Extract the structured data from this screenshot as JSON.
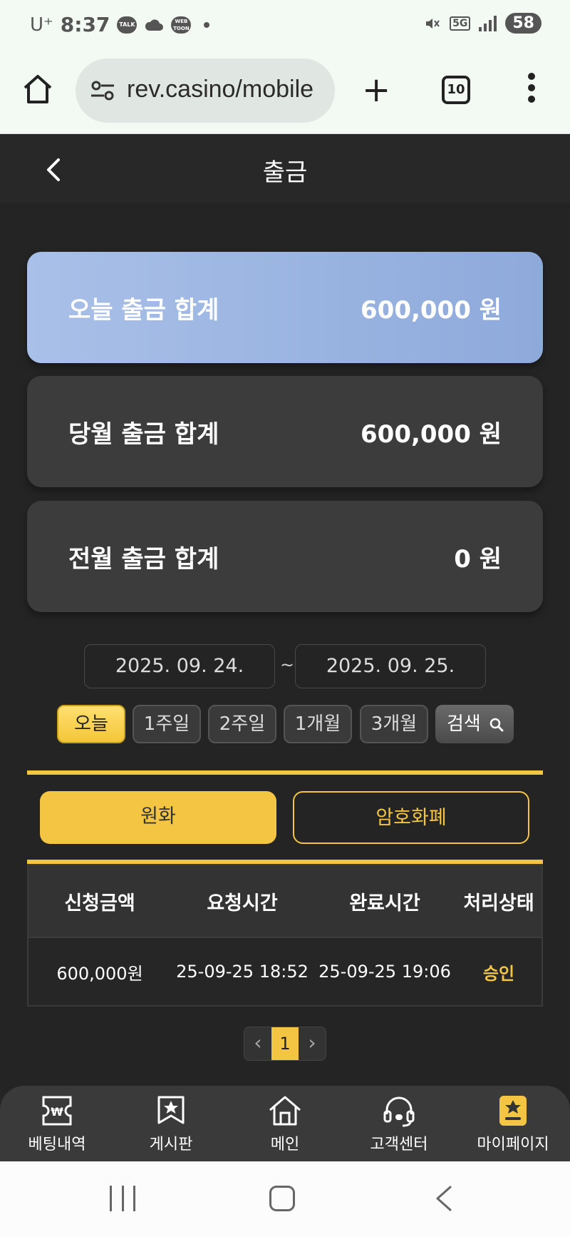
{
  "status_bar": {
    "carrier": "U⁺",
    "time": "8:37",
    "notif_talk": "TALK",
    "notif_webtoon": "WEB TOON",
    "network": "5G",
    "battery": "58"
  },
  "browser": {
    "url": "rev.casino/mobile",
    "tab_count": "10"
  },
  "header": {
    "title": "출금"
  },
  "summary": {
    "today_label": "오늘 출금 합계",
    "today_value": "600,000 원",
    "month_label": "당월 출금 합계",
    "month_value": "600,000 원",
    "prev_label": "전월 출금 합계",
    "prev_value": "0 원"
  },
  "filter": {
    "date_start": "2025. 09. 24.",
    "date_end": "2025. 09. 25.",
    "separator": "~",
    "periods": [
      "오늘",
      "1주일",
      "2주일",
      "1개월",
      "3개월"
    ],
    "active_period": "오늘",
    "search_label": "검색"
  },
  "currency_tabs": {
    "won": "원화",
    "crypto": "암호화폐",
    "active": "원화"
  },
  "table": {
    "headers": [
      "신청금액",
      "요청시간",
      "완료시간",
      "처리상태"
    ],
    "rows": [
      {
        "amount": "600,000원",
        "requested": "25-09-25 18:52",
        "completed": "25-09-25 19:06",
        "status": "승인"
      }
    ]
  },
  "pagination": {
    "current": "1",
    "prev": "‹",
    "next": "›"
  },
  "bottom_nav": {
    "items": [
      {
        "label": "베팅내역",
        "icon": "ticket-won-icon"
      },
      {
        "label": "게시판",
        "icon": "bookmark-star-icon"
      },
      {
        "label": "메인",
        "icon": "home-icon"
      },
      {
        "label": "고객센터",
        "icon": "headset-icon"
      },
      {
        "label": "마이페이지",
        "icon": "mypage-star-icon"
      }
    ]
  },
  "colors": {
    "accent": "#f4c542",
    "background": "#242424",
    "card": "#3c3c3c",
    "today_card": "#a9c0e8"
  }
}
